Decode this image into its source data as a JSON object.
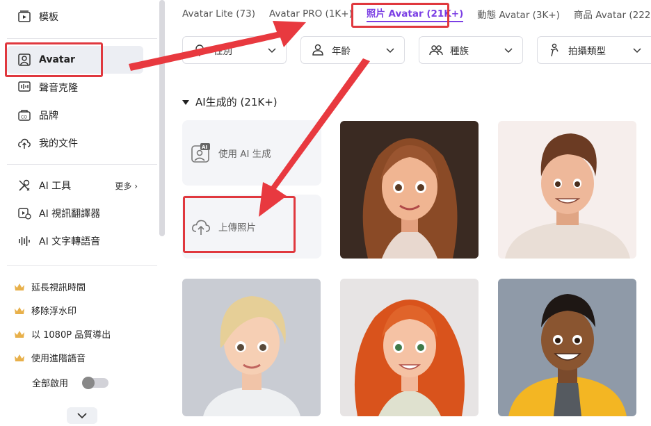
{
  "sidebar": {
    "items": [
      {
        "label": "模板",
        "icon": "template-icon"
      },
      {
        "label": "Avatar",
        "icon": "avatar-icon",
        "active": true
      },
      {
        "label": "聲音克隆",
        "icon": "voice-clone-icon"
      },
      {
        "label": "品牌",
        "icon": "brand-icon"
      },
      {
        "label": "我的文件",
        "icon": "cloud-upload-icon"
      }
    ],
    "tools": [
      {
        "label": "AI 工具",
        "icon": "tools-icon"
      },
      {
        "label": "AI 視訊翻譯器",
        "icon": "video-translate-icon"
      },
      {
        "label": "AI 文字轉語音",
        "icon": "waveform-icon"
      }
    ],
    "more_label": "更多",
    "features": [
      "延長視訊時間",
      "移除浮水印",
      "以 1080P 品質導出",
      "使用進階語音"
    ],
    "enable_all_label": "全部啟用",
    "enable_all_on": false
  },
  "tabs": [
    {
      "label": "Avatar Lite (73)"
    },
    {
      "label": "Avatar PRO (1K+)"
    },
    {
      "label": "照片 Avatar (21K+)",
      "active": true
    },
    {
      "label": "動態 Avatar (3K+)"
    },
    {
      "label": "商品 Avatar (222)"
    }
  ],
  "filters": [
    {
      "label": "性別",
      "icon": "gender-icon"
    },
    {
      "label": "年齡",
      "icon": "age-icon"
    },
    {
      "label": "種族",
      "icon": "people-icon"
    },
    {
      "label": "拍攝類型",
      "icon": "pose-icon"
    }
  ],
  "section": {
    "title": "AI生成的 (21K+)"
  },
  "actions": {
    "generate_label": "使用 AI 生成",
    "upload_label": "上傳照片"
  },
  "colors": {
    "accent": "#7b3fe4",
    "highlight": "#e0383e",
    "crown": "#e8b04a"
  }
}
